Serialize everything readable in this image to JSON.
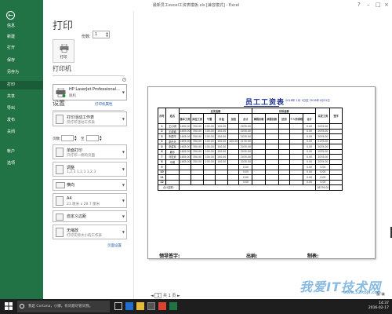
{
  "window": {
    "title": "最新员工excel工资表模板.xls [兼容模式] - Excel"
  },
  "sidebar": {
    "items": [
      {
        "label": "信息"
      },
      {
        "label": "新建"
      },
      {
        "label": "打开"
      },
      {
        "label": "保存"
      },
      {
        "label": "另存为"
      },
      {
        "label": "打印"
      },
      {
        "label": "共享"
      },
      {
        "label": "导出"
      },
      {
        "label": "发布"
      },
      {
        "label": "关闭"
      },
      {
        "label": "帐户"
      },
      {
        "label": "选项"
      }
    ],
    "active": "打印"
  },
  "print": {
    "heading": "打印",
    "button_label": "打印",
    "copies_label": "份数:",
    "copies_value": "1"
  },
  "printer": {
    "heading": "打印机",
    "name": "HP LaserJet Professional...",
    "status": "脱机",
    "properties_link": "打印机属性"
  },
  "settings": {
    "heading": "设置",
    "scope": {
      "main": "打印活动工作表",
      "sub": "仅打印活动工作表"
    },
    "pages_label": "页数:",
    "pages_to": "至",
    "sides": {
      "main": "单面打印",
      "sub": "只打印一侧的页面"
    },
    "collate": {
      "main": "调整",
      "sub": "1,2,3    1,2,3    1,2,3"
    },
    "orientation": {
      "main": "横向"
    },
    "paper": {
      "main": "A4",
      "sub": "21 厘米 x 29.7 厘米"
    },
    "margins": {
      "main": "自定义边距"
    },
    "scaling": {
      "main": "无缩放",
      "sub": "打印实际大小的工作表"
    },
    "page_setup_link": "页面设置"
  },
  "preview": {
    "sheet_title": "员工工资表",
    "sheet_date": "2016年  1月  1日至  2016年1月31日",
    "table": {
      "group_headers": [
        "序号",
        "姓名",
        "应发金额",
        "扣除金额",
        "实发工资",
        "签字"
      ],
      "earn_cols": [
        "基本工资",
        "岗位工资",
        "午餐",
        "补贴",
        "加班",
        "合计"
      ],
      "ded_cols": [
        "事假扣款",
        "病假扣款",
        "迟到",
        "个人所得税",
        "合计"
      ],
      "rows": [
        {
          "sn": "1",
          "name": "王小明",
          "cells": [
            "1485.00",
            "350.00",
            "100.00",
            "100.00",
            "",
            "2035.00",
            "",
            "",
            "",
            "",
            "0.00",
            "2035.00"
          ]
        },
        {
          "sn": "2",
          "name": "王德德",
          "cells": [
            "1485.00",
            "350.00",
            "100.00",
            "100.00",
            "",
            "2035.00",
            "",
            "",
            "",
            "",
            "0.00",
            "2035.00"
          ]
        },
        {
          "sn": "3",
          "name": "朱国华",
          "cells": [
            "1485.00",
            "350.00",
            "100.00",
            "100.00",
            "",
            "2035.00",
            "",
            "",
            "",
            "",
            "0.00",
            "2035.00"
          ]
        },
        {
          "sn": "4",
          "name": "李丹丹",
          "cells": [
            "1485.00",
            "350.00",
            "100.00",
            "100.00",
            "100.00",
            "2135.00",
            "",
            "",
            "",
            "",
            "0.00",
            "2135.00"
          ]
        },
        {
          "sn": "5",
          "name": "张建军",
          "cells": [
            "1485.00",
            "350.00",
            "100.00",
            "100.00",
            "",
            "2035.00",
            "",
            "",
            "",
            "",
            "0.00",
            "2035.00"
          ]
        },
        {
          "sn": "6",
          "name": "魏东",
          "cells": [
            "1485.00",
            "350.00",
            "100.00",
            "100.00",
            "",
            "2035.00",
            "",
            "",
            "",
            "",
            "0.00",
            "2035.00"
          ]
        },
        {
          "sn": "7",
          "name": "马宏武",
          "cells": [
            "1485.00",
            "350.00",
            "100.00",
            "100.00",
            "",
            "2035.00",
            "",
            "",
            "",
            "",
            "0.00",
            "2035.00"
          ]
        },
        {
          "sn": "8",
          "name": "马明",
          "cells": [
            "1485.00",
            "350.00",
            "100.00",
            "100.00",
            "",
            "2035.00",
            "",
            "",
            "",
            "",
            "0.00",
            "2035.00"
          ]
        },
        {
          "sn": "9",
          "name": "",
          "cells": [
            "",
            "",
            "",
            "",
            "",
            "0.00",
            "",
            "",
            "",
            "",
            "0.00",
            "0.00"
          ]
        },
        {
          "sn": "10",
          "name": "",
          "cells": [
            "",
            "",
            "",
            "",
            "",
            "0.00",
            "",
            "",
            "",
            "",
            "0.00",
            "0.00"
          ]
        },
        {
          "sn": "11",
          "name": "",
          "cells": [
            "",
            "",
            "",
            "",
            "",
            "0.00",
            "",
            "",
            "",
            "",
            "0.00",
            "0.00"
          ]
        },
        {
          "sn": "12",
          "name": "",
          "cells": [
            "",
            "",
            "",
            "",
            "",
            "0.00",
            "",
            "",
            "",
            "",
            "0.00",
            "0.00"
          ]
        }
      ],
      "total_label": "合计金额:",
      "total_value": "16376.00"
    },
    "sign_leader": "领导签字:",
    "sign_cashier": "出纳:",
    "sign_maker": "制表:",
    "page_current": "1",
    "page_total": "共 1 页"
  },
  "taskbar": {
    "search_text": "我是 Cortana，小娜。有问题尽管问我。",
    "time": "14:37",
    "date": "2016-02-17"
  },
  "watermark": {
    "text": "我爱IT技术网",
    "sub": "www.52itbjs.com"
  }
}
